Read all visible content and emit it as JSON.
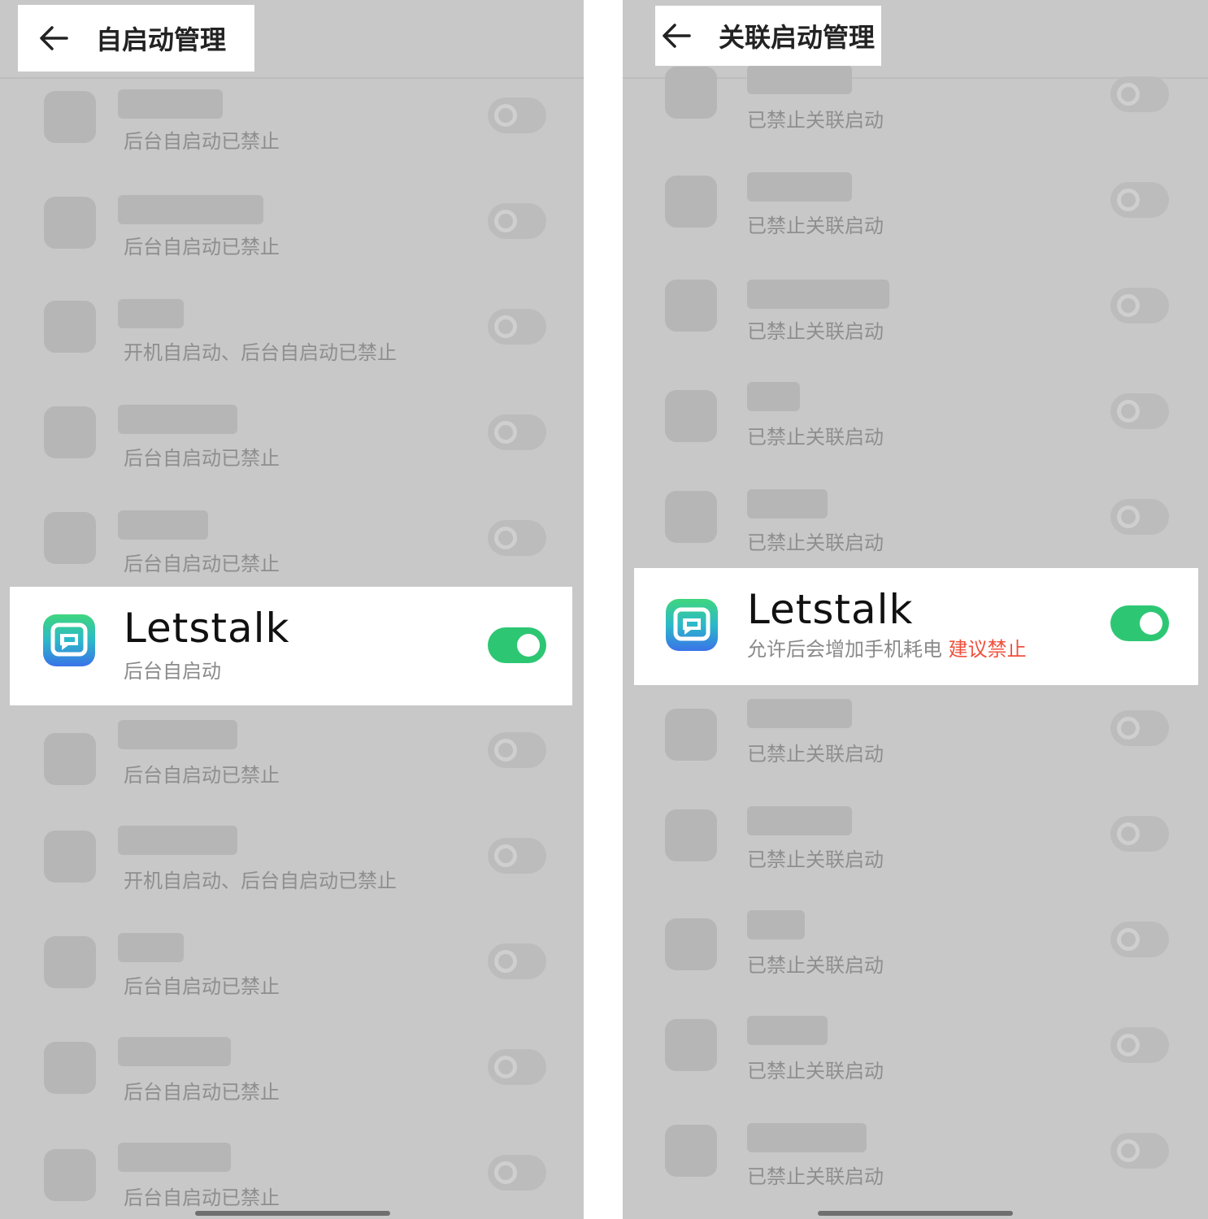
{
  "left": {
    "title": "自启动管理",
    "rows_above": [
      {
        "status": "后台自启动已禁止"
      },
      {
        "status": "后台自启动已禁止"
      },
      {
        "status": "开机自启动、后台自启动已禁止"
      },
      {
        "status": "后台自启动已禁止"
      },
      {
        "status": "后台自启动已禁止"
      }
    ],
    "highlight": {
      "app_name": "Letstalk",
      "status": "后台自启动",
      "toggle_on": true
    },
    "rows_below": [
      {
        "status": "后台自启动已禁止"
      },
      {
        "status": "开机自启动、后台自启动已禁止"
      },
      {
        "status": "后台自启动已禁止"
      },
      {
        "status": "后台自启动已禁止"
      },
      {
        "status": "后台自启动已禁止"
      }
    ]
  },
  "right": {
    "title": "关联启动管理",
    "rows_above": [
      {
        "status": "已禁止关联启动"
      },
      {
        "status": "已禁止关联启动"
      },
      {
        "status": "已禁止关联启动"
      },
      {
        "status": "已禁止关联启动"
      },
      {
        "status": "已禁止关联启动"
      }
    ],
    "highlight": {
      "app_name": "Letstalk",
      "status": "允许后会增加手机耗电",
      "warning": "建议禁止",
      "toggle_on": true
    },
    "rows_below": [
      {
        "status": "已禁止关联启动"
      },
      {
        "status": "已禁止关联启动"
      },
      {
        "status": "已禁止关联启动"
      },
      {
        "status": "已禁止关联启动"
      },
      {
        "status": "已禁止关联启动"
      }
    ]
  },
  "colors": {
    "toggle_on": "#2dc774",
    "warning_text": "#f0503c",
    "overlay": "#c8c8c8"
  }
}
